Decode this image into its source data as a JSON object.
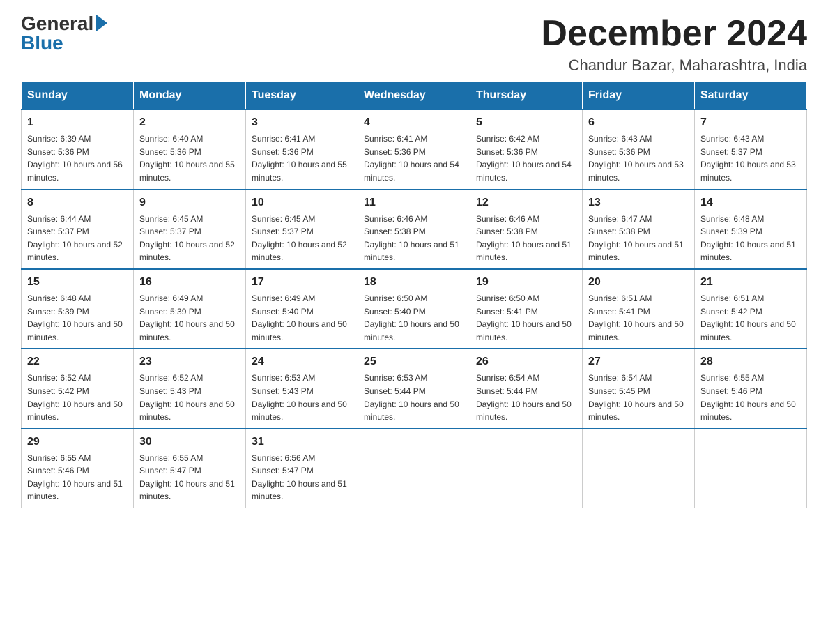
{
  "logo": {
    "general": "General",
    "blue": "Blue"
  },
  "header": {
    "month": "December 2024",
    "location": "Chandur Bazar, Maharashtra, India"
  },
  "days_of_week": [
    "Sunday",
    "Monday",
    "Tuesday",
    "Wednesday",
    "Thursday",
    "Friday",
    "Saturday"
  ],
  "weeks": [
    [
      {
        "day": 1,
        "sunrise": "6:39 AM",
        "sunset": "5:36 PM",
        "daylight": "10 hours and 56 minutes."
      },
      {
        "day": 2,
        "sunrise": "6:40 AM",
        "sunset": "5:36 PM",
        "daylight": "10 hours and 55 minutes."
      },
      {
        "day": 3,
        "sunrise": "6:41 AM",
        "sunset": "5:36 PM",
        "daylight": "10 hours and 55 minutes."
      },
      {
        "day": 4,
        "sunrise": "6:41 AM",
        "sunset": "5:36 PM",
        "daylight": "10 hours and 54 minutes."
      },
      {
        "day": 5,
        "sunrise": "6:42 AM",
        "sunset": "5:36 PM",
        "daylight": "10 hours and 54 minutes."
      },
      {
        "day": 6,
        "sunrise": "6:43 AM",
        "sunset": "5:36 PM",
        "daylight": "10 hours and 53 minutes."
      },
      {
        "day": 7,
        "sunrise": "6:43 AM",
        "sunset": "5:37 PM",
        "daylight": "10 hours and 53 minutes."
      }
    ],
    [
      {
        "day": 8,
        "sunrise": "6:44 AM",
        "sunset": "5:37 PM",
        "daylight": "10 hours and 52 minutes."
      },
      {
        "day": 9,
        "sunrise": "6:45 AM",
        "sunset": "5:37 PM",
        "daylight": "10 hours and 52 minutes."
      },
      {
        "day": 10,
        "sunrise": "6:45 AM",
        "sunset": "5:37 PM",
        "daylight": "10 hours and 52 minutes."
      },
      {
        "day": 11,
        "sunrise": "6:46 AM",
        "sunset": "5:38 PM",
        "daylight": "10 hours and 51 minutes."
      },
      {
        "day": 12,
        "sunrise": "6:46 AM",
        "sunset": "5:38 PM",
        "daylight": "10 hours and 51 minutes."
      },
      {
        "day": 13,
        "sunrise": "6:47 AM",
        "sunset": "5:38 PM",
        "daylight": "10 hours and 51 minutes."
      },
      {
        "day": 14,
        "sunrise": "6:48 AM",
        "sunset": "5:39 PM",
        "daylight": "10 hours and 51 minutes."
      }
    ],
    [
      {
        "day": 15,
        "sunrise": "6:48 AM",
        "sunset": "5:39 PM",
        "daylight": "10 hours and 50 minutes."
      },
      {
        "day": 16,
        "sunrise": "6:49 AM",
        "sunset": "5:39 PM",
        "daylight": "10 hours and 50 minutes."
      },
      {
        "day": 17,
        "sunrise": "6:49 AM",
        "sunset": "5:40 PM",
        "daylight": "10 hours and 50 minutes."
      },
      {
        "day": 18,
        "sunrise": "6:50 AM",
        "sunset": "5:40 PM",
        "daylight": "10 hours and 50 minutes."
      },
      {
        "day": 19,
        "sunrise": "6:50 AM",
        "sunset": "5:41 PM",
        "daylight": "10 hours and 50 minutes."
      },
      {
        "day": 20,
        "sunrise": "6:51 AM",
        "sunset": "5:41 PM",
        "daylight": "10 hours and 50 minutes."
      },
      {
        "day": 21,
        "sunrise": "6:51 AM",
        "sunset": "5:42 PM",
        "daylight": "10 hours and 50 minutes."
      }
    ],
    [
      {
        "day": 22,
        "sunrise": "6:52 AM",
        "sunset": "5:42 PM",
        "daylight": "10 hours and 50 minutes."
      },
      {
        "day": 23,
        "sunrise": "6:52 AM",
        "sunset": "5:43 PM",
        "daylight": "10 hours and 50 minutes."
      },
      {
        "day": 24,
        "sunrise": "6:53 AM",
        "sunset": "5:43 PM",
        "daylight": "10 hours and 50 minutes."
      },
      {
        "day": 25,
        "sunrise": "6:53 AM",
        "sunset": "5:44 PM",
        "daylight": "10 hours and 50 minutes."
      },
      {
        "day": 26,
        "sunrise": "6:54 AM",
        "sunset": "5:44 PM",
        "daylight": "10 hours and 50 minutes."
      },
      {
        "day": 27,
        "sunrise": "6:54 AM",
        "sunset": "5:45 PM",
        "daylight": "10 hours and 50 minutes."
      },
      {
        "day": 28,
        "sunrise": "6:55 AM",
        "sunset": "5:46 PM",
        "daylight": "10 hours and 50 minutes."
      }
    ],
    [
      {
        "day": 29,
        "sunrise": "6:55 AM",
        "sunset": "5:46 PM",
        "daylight": "10 hours and 51 minutes."
      },
      {
        "day": 30,
        "sunrise": "6:55 AM",
        "sunset": "5:47 PM",
        "daylight": "10 hours and 51 minutes."
      },
      {
        "day": 31,
        "sunrise": "6:56 AM",
        "sunset": "5:47 PM",
        "daylight": "10 hours and 51 minutes."
      },
      null,
      null,
      null,
      null
    ]
  ]
}
